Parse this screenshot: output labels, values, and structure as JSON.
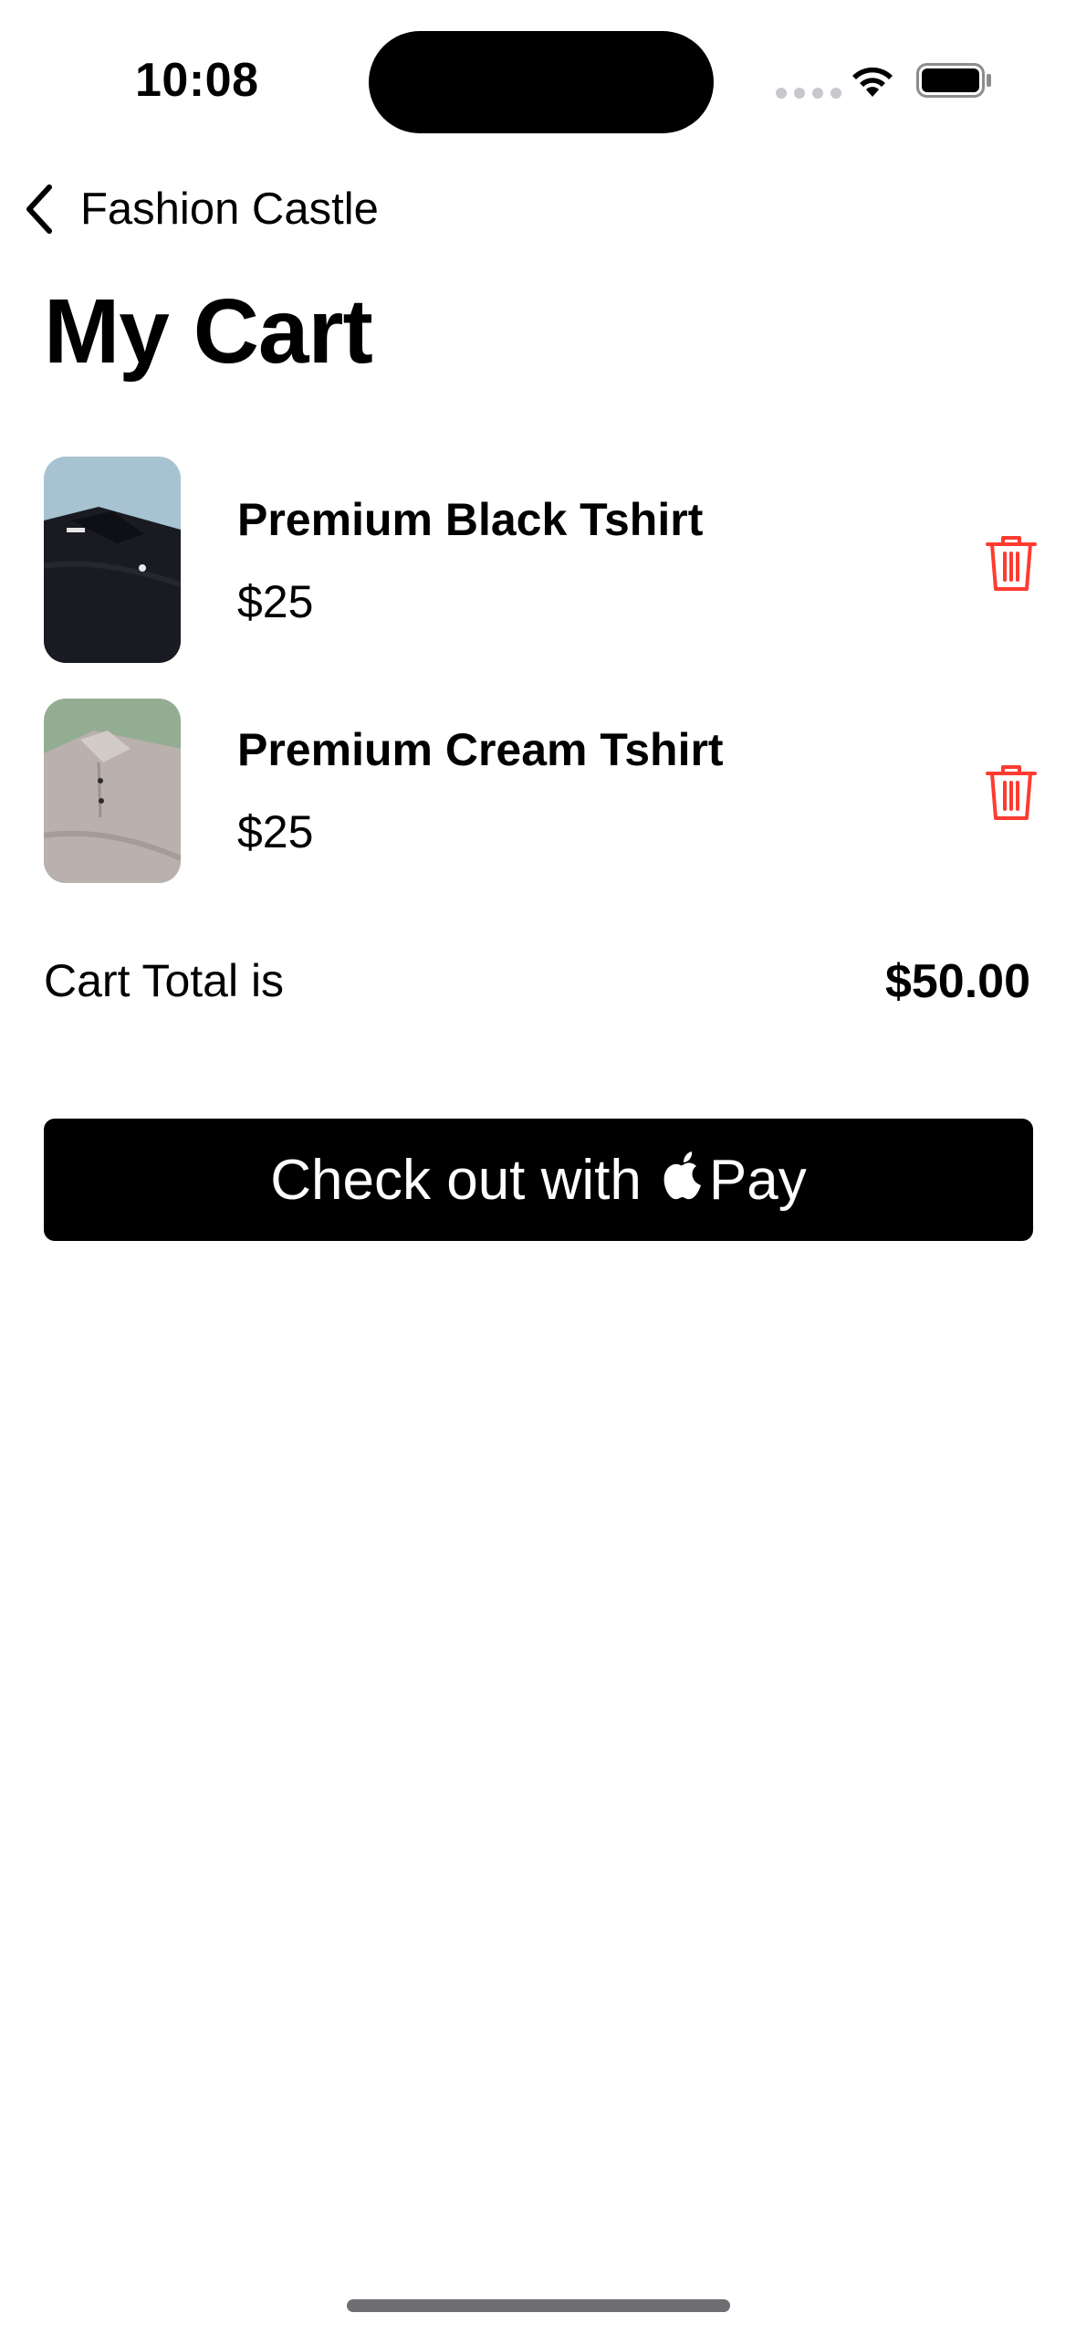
{
  "status_bar": {
    "time": "10:08"
  },
  "nav": {
    "back_label": "Fashion Castle"
  },
  "page": {
    "title": "My Cart"
  },
  "cart": {
    "items": [
      {
        "name": "Premium Black Tshirt",
        "price": "$25",
        "image": "black-tshirt-photo"
      },
      {
        "name": "Premium Cream Tshirt",
        "price": "$25",
        "image": "cream-tshirt-photo"
      }
    ],
    "total_label": "Cart Total is",
    "total_value": "$50.00"
  },
  "checkout": {
    "label_prefix": "Check out with",
    "label_suffix": "Pay"
  },
  "colors": {
    "trash_icon": "#ff3b30",
    "button_bg": "#000000"
  },
  "icons": {
    "back": "chevron-left-icon",
    "delete": "trash-icon",
    "apple": "apple-logo-icon",
    "wifi": "wifi-icon",
    "battery": "battery-icon"
  }
}
